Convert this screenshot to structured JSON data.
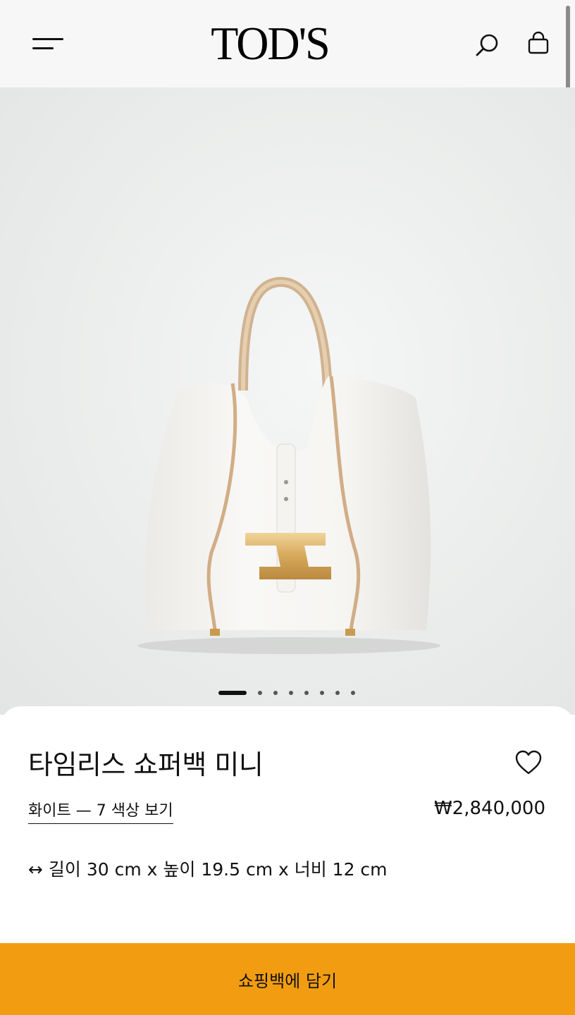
{
  "header": {
    "logo_text": "TOD'S",
    "icons": {
      "menu": "hamburger-menu-icon",
      "search": "search-icon",
      "bag": "shopping-bag-icon"
    }
  },
  "carousel": {
    "image_count": 8,
    "active_index": 0
  },
  "product": {
    "title": "타임리스 쇼퍼백 미니",
    "color_link": "화이트 — 7 색상 보기",
    "price": "₩2,840,000",
    "dimensions": "↔ 길이 30 cm x 높이 19.5 cm x 너비 12 cm",
    "wishlist_icon": "heart-outline-icon"
  },
  "cta": {
    "label": "쇼핑백에 담기"
  },
  "colors": {
    "accent": "#f29d11",
    "header_bg": "#f7f7f7",
    "text": "#111111"
  }
}
